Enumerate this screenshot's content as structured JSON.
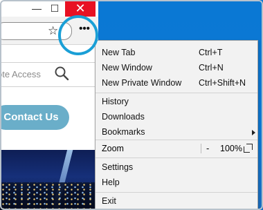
{
  "window": {
    "minimize_glyph": "—",
    "maximize_glyph": "☐",
    "close_glyph": "✕"
  },
  "toolbar": {
    "bookmark_icon": "star-icon",
    "more_glyph": "•••"
  },
  "page": {
    "search_text": "ote Access",
    "contact_label": "Contact Us"
  },
  "menu": {
    "items": [
      {
        "label": "New Tab",
        "shortcut": "Ctrl+T"
      },
      {
        "label": "New Window",
        "shortcut": "Ctrl+N"
      },
      {
        "label": "New Private Window",
        "shortcut": "Ctrl+Shift+N"
      },
      {
        "label": "History",
        "shortcut": ""
      },
      {
        "label": "Downloads",
        "shortcut": ""
      },
      {
        "label": "Bookmarks",
        "shortcut": ""
      },
      {
        "label": "Settings",
        "shortcut": ""
      },
      {
        "label": "Help",
        "shortcut": ""
      },
      {
        "label": "Exit",
        "shortcut": ""
      }
    ],
    "zoom": {
      "label": "Zoom",
      "minus": "-",
      "value": "100%"
    }
  },
  "colors": {
    "close_button": "#e81123",
    "highlight_ring": "#1a9fd6",
    "contact_button": "#6aaec9",
    "desktop": "#0a78d4"
  }
}
